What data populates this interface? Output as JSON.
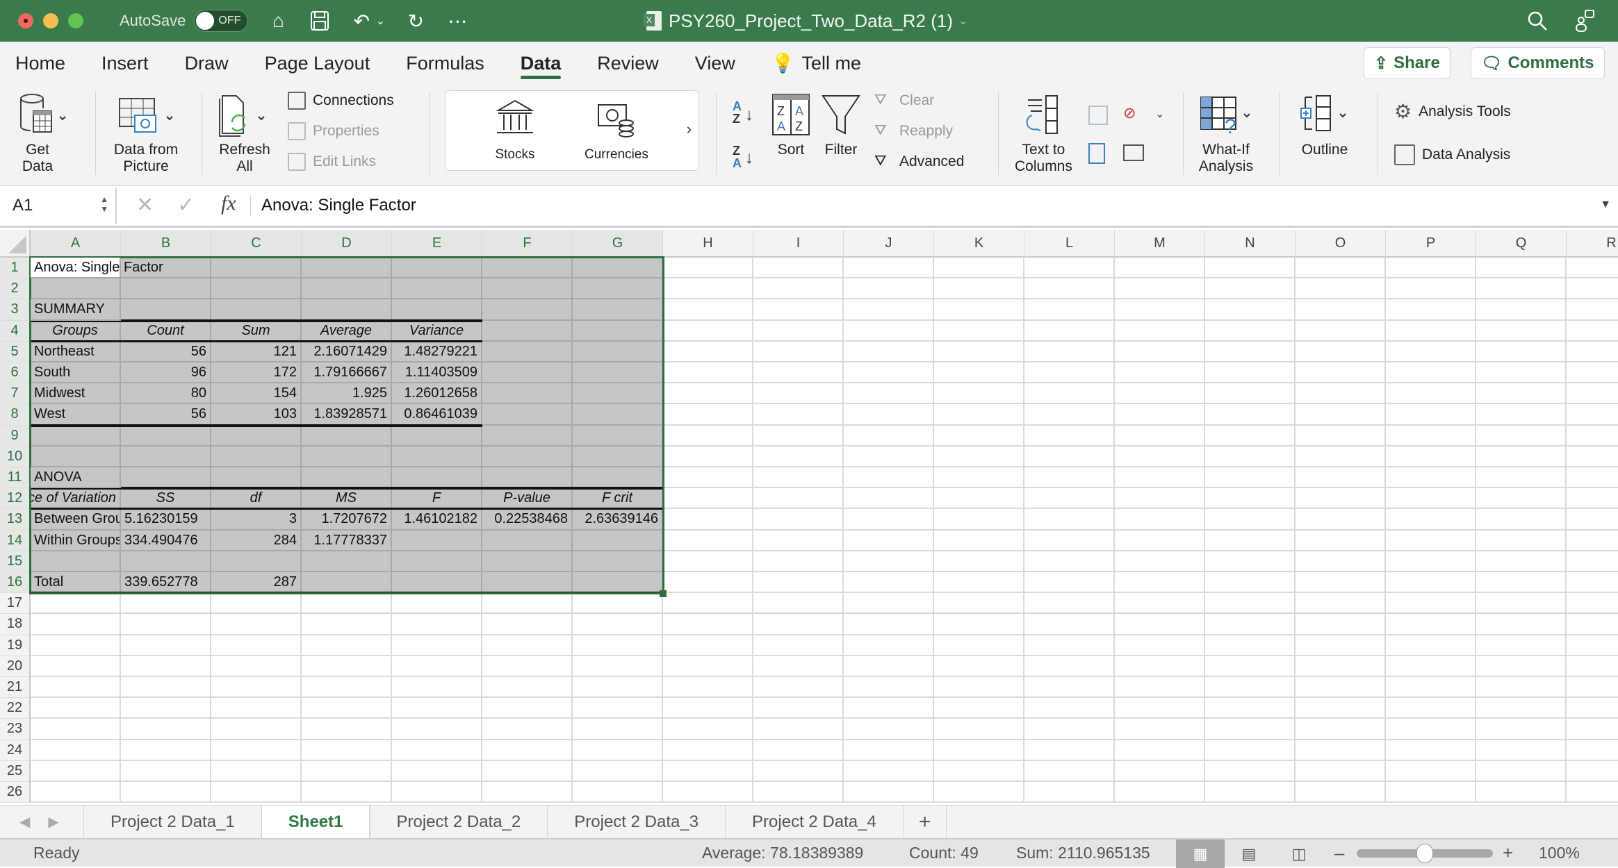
{
  "titlebar": {
    "autosave_label": "AutoSave",
    "autosave_state": "OFF",
    "document_title": "PSY260_Project_Two_Data_R2 (1)"
  },
  "menu": {
    "tabs": [
      "Home",
      "Insert",
      "Draw",
      "Page Layout",
      "Formulas",
      "Data",
      "Review",
      "View"
    ],
    "active_tab": "Data",
    "tell_me": "Tell me",
    "share": "Share",
    "comments": "Comments"
  },
  "ribbon": {
    "get_data": [
      "Get",
      "Data"
    ],
    "data_from_picture": [
      "Data from",
      "Picture"
    ],
    "refresh_all": [
      "Refresh",
      "All"
    ],
    "connections": "Connections",
    "properties": "Properties",
    "edit_links": "Edit Links",
    "stocks": "Stocks",
    "currencies": "Currencies",
    "sort": "Sort",
    "filter": "Filter",
    "clear": "Clear",
    "reapply": "Reapply",
    "advanced": "Advanced",
    "text_to_columns": [
      "Text to",
      "Columns"
    ],
    "what_if": [
      "What-If",
      "Analysis"
    ],
    "outline": "Outline",
    "analysis_tools": "Analysis Tools",
    "data_analysis": "Data Analysis"
  },
  "formula_bar": {
    "name_box": "A1",
    "fx": "fx",
    "content": "Anova: Single Factor"
  },
  "sheet": {
    "columns": [
      "A",
      "B",
      "C",
      "D",
      "E",
      "F",
      "G",
      "H",
      "I",
      "J",
      "K",
      "L",
      "M",
      "N",
      "O",
      "P",
      "Q",
      "R"
    ],
    "row_count": 26,
    "cells": {
      "A1": "Anova: Single Factor",
      "A3": "SUMMARY",
      "A4": "Groups",
      "B4": "Count",
      "C4": "Sum",
      "D4": "Average",
      "E4": "Variance",
      "A5": "Northeast",
      "B5": "56",
      "C5": "121",
      "D5": "2.16071429",
      "E5": "1.48279221",
      "A6": "South",
      "B6": "96",
      "C6": "172",
      "D6": "1.79166667",
      "E6": "1.11403509",
      "A7": "Midwest",
      "B7": "80",
      "C7": "154",
      "D7": "1.925",
      "E7": "1.26012658",
      "A8": "West",
      "B8": "56",
      "C8": "103",
      "D8": "1.83928571",
      "E8": "0.86461039",
      "A11": "ANOVA",
      "A12": "Source of Variation",
      "B12": "SS",
      "C12": "df",
      "D12": "MS",
      "E12": "F",
      "F12": "P-value",
      "G12": "F crit",
      "A13": "Between Groups",
      "B13": "5.16230159",
      "C13": "3",
      "D13": "1.7207672",
      "E13": "1.46102182",
      "F13": "0.22538468",
      "G13": "2.63639146",
      "A14": "Within Groups",
      "B14": "334.490476",
      "C14": "284",
      "D14": "1.17778337",
      "A16": "Total",
      "B16": "339.652778",
      "C16": "287"
    },
    "selection": "A1:G16"
  },
  "sheet_tabs": {
    "tabs": [
      "Project 2 Data_1",
      "Sheet1",
      "Project 2 Data_2",
      "Project 2 Data_3",
      "Project 2 Data_4"
    ],
    "active": "Sheet1",
    "add": "+"
  },
  "status": {
    "mode": "Ready",
    "average": "Average: 78.18389389",
    "count": "Count: 49",
    "sum": "Sum: 2110.965135",
    "zoom": "100%",
    "zoom_fraction": 0.5
  },
  "colors": {
    "accent": "#2f6e3f",
    "titlebar": "#3b7a4a",
    "selection_fill": "#c6c6c6"
  }
}
